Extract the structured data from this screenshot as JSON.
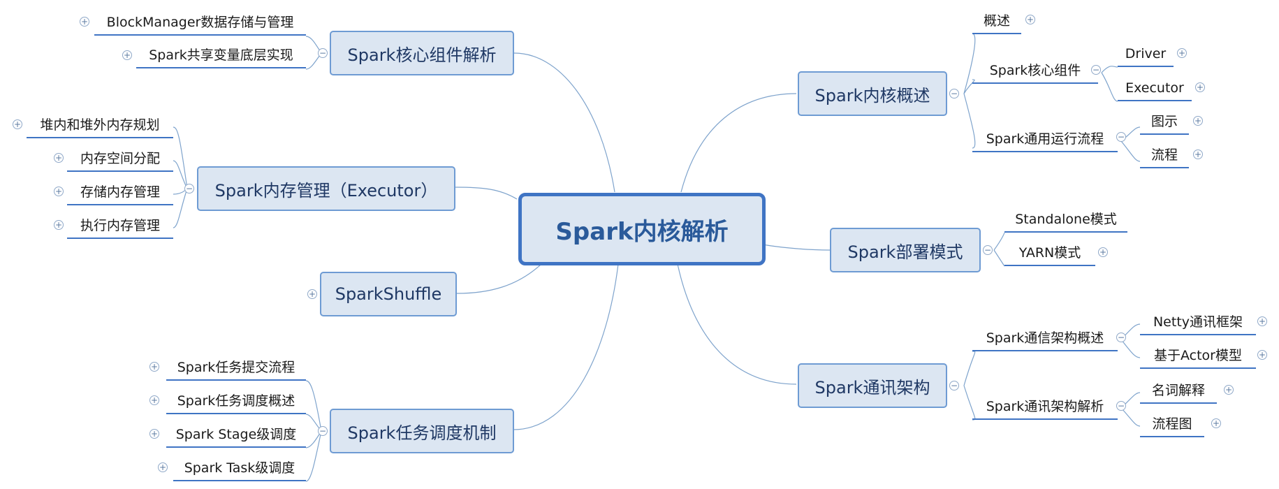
{
  "colors": {
    "accent": "#3f74c4",
    "node_fill": "#dce6f2",
    "connector": "#7ea3cc"
  },
  "toggles": {
    "expand": "+",
    "collapse": "−"
  },
  "mindmap": {
    "root": "Spark内核解析",
    "branches": {
      "core_components": {
        "label": "Spark核心组件解析",
        "children": [
          "BlockManager数据存储与管理",
          "Spark共享变量底层实现"
        ]
      },
      "memory": {
        "label": "Spark内存管理（Executor）",
        "children": [
          "堆内和堆外内存规划",
          "内存空间分配",
          "存储内存管理",
          "执行内存管理"
        ]
      },
      "shuffle": {
        "label": "SparkShuffle"
      },
      "scheduling": {
        "label": "Spark任务调度机制",
        "children": [
          "Spark任务提交流程",
          "Spark任务调度概述",
          "Spark Stage级调度",
          "Spark Task级调度"
        ]
      },
      "kernel_overview": {
        "label": "Spark内核概述",
        "overview": "概述",
        "components": {
          "label": "Spark核心组件",
          "children": [
            "Driver",
            "Executor"
          ]
        },
        "flow": {
          "label": "Spark通用运行流程",
          "children": [
            "图示",
            "流程"
          ]
        }
      },
      "deploy": {
        "label": "Spark部署模式",
        "children": [
          "Standalone模式",
          "YARN模式"
        ]
      },
      "comm": {
        "label": "Spark通讯架构",
        "overview": {
          "label": "Spark通信架构概述",
          "children": [
            "Netty通讯框架",
            "基于Actor模型"
          ]
        },
        "analysis": {
          "label": "Spark通讯架构解析",
          "children": [
            "名词解释",
            "流程图"
          ]
        }
      }
    }
  }
}
